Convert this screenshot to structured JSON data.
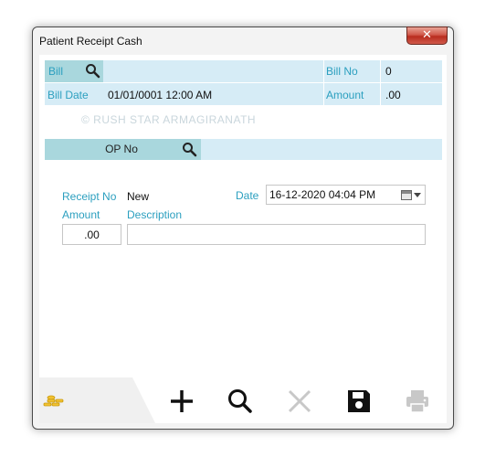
{
  "window": {
    "title": "Patient Receipt Cash",
    "close_glyph": "✕"
  },
  "bill": {
    "label": "Bill",
    "search_icon": "search-icon",
    "bill_no_label": "Bill No",
    "bill_no_value": "0",
    "bill_date_label": "Bill Date",
    "bill_date_value": "01/01/0001 12:00 AM",
    "amount_label": "Amount",
    "amount_value": ".00",
    "watermark": "© RUSH STAR ARMAGIRANATH"
  },
  "op": {
    "label": "OP No",
    "search_icon": "search-icon"
  },
  "receipt": {
    "receipt_no_label": "Receipt No",
    "receipt_no_value": "New",
    "date_label": "Date",
    "date_value": "16-12-2020 04:04 PM",
    "amount_label": "Amount",
    "amount_value": ".00",
    "description_label": "Description",
    "description_value": ""
  },
  "toolbar": {
    "icons": [
      "coins-icon",
      "add-icon",
      "search-icon",
      "delete-icon",
      "save-icon",
      "print-icon"
    ]
  },
  "colors": {
    "label_blue": "#2b9fbf",
    "header_band": "#d6ecf6",
    "tile": "#a9d7dd"
  }
}
